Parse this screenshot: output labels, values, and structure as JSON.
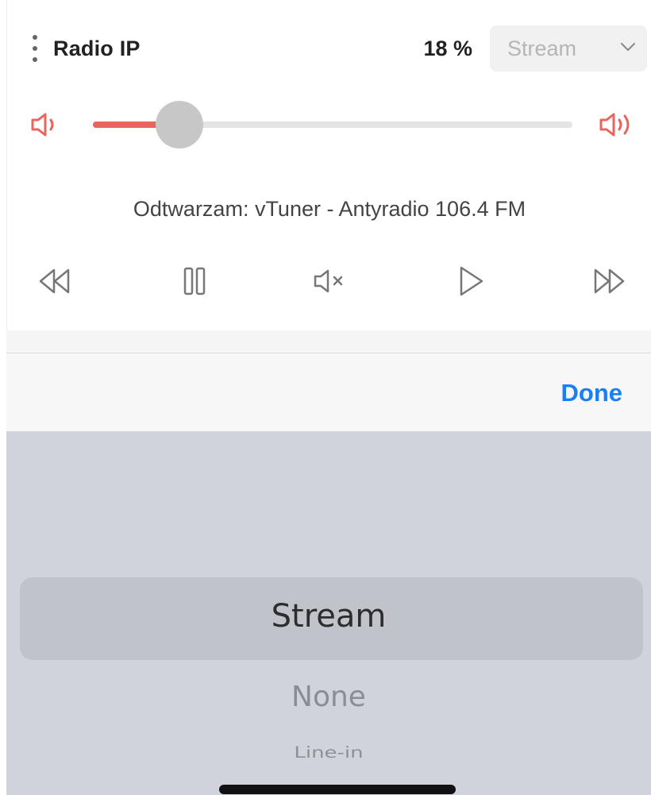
{
  "header": {
    "title": "Radio IP",
    "volume_text": "18 %",
    "source_select_value": "Stream"
  },
  "slider": {
    "volume_fraction": 0.18
  },
  "now_playing": "Odtwarzam: vTuner - Antyradio 106.4 FM",
  "controls": [
    "rewind",
    "pause",
    "mute",
    "play",
    "fast-forward"
  ],
  "toolbar": {
    "done_label": "Done"
  },
  "picker": {
    "selected": "Stream",
    "options": [
      "None",
      "Line-in"
    ]
  },
  "colors": {
    "accent": "#e9645d",
    "done_blue": "#1a7ff5",
    "picker_bg": "#d0d4da"
  }
}
